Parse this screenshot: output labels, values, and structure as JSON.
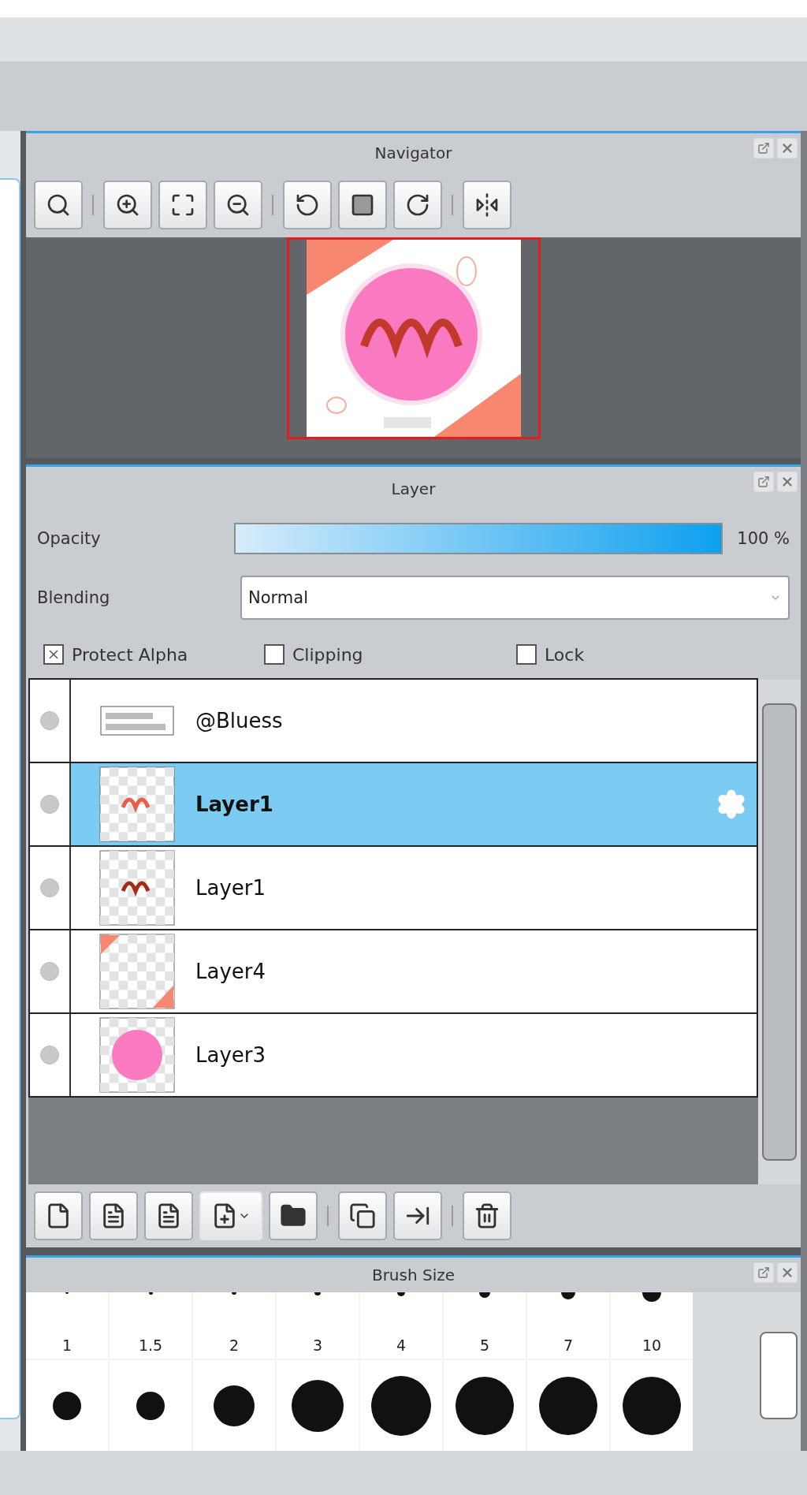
{
  "navigator": {
    "title": "Navigator"
  },
  "layer_panel": {
    "title": "Layer",
    "opacity": {
      "label": "Opacity",
      "level": 1,
      "reading": "100 %"
    },
    "blending": {
      "label": "Blending",
      "value": "Normal"
    },
    "options": [
      {
        "label": "Protect Alpha",
        "checked": true
      },
      {
        "label": "Clipping",
        "checked": false
      },
      {
        "label": "Lock",
        "checked": false
      }
    ],
    "layers": [
      {
        "name": "@Bluess",
        "selected": false
      },
      {
        "name": "Layer1",
        "selected": true
      },
      {
        "name": "Layer1",
        "selected": false
      },
      {
        "name": "Layer4",
        "selected": false
      },
      {
        "name": "Layer3",
        "selected": false
      }
    ]
  },
  "brush_size": {
    "title": "Brush Size",
    "labels": [
      "1",
      "1.5",
      "2",
      "3",
      "4",
      "5",
      "7",
      "10"
    ]
  }
}
